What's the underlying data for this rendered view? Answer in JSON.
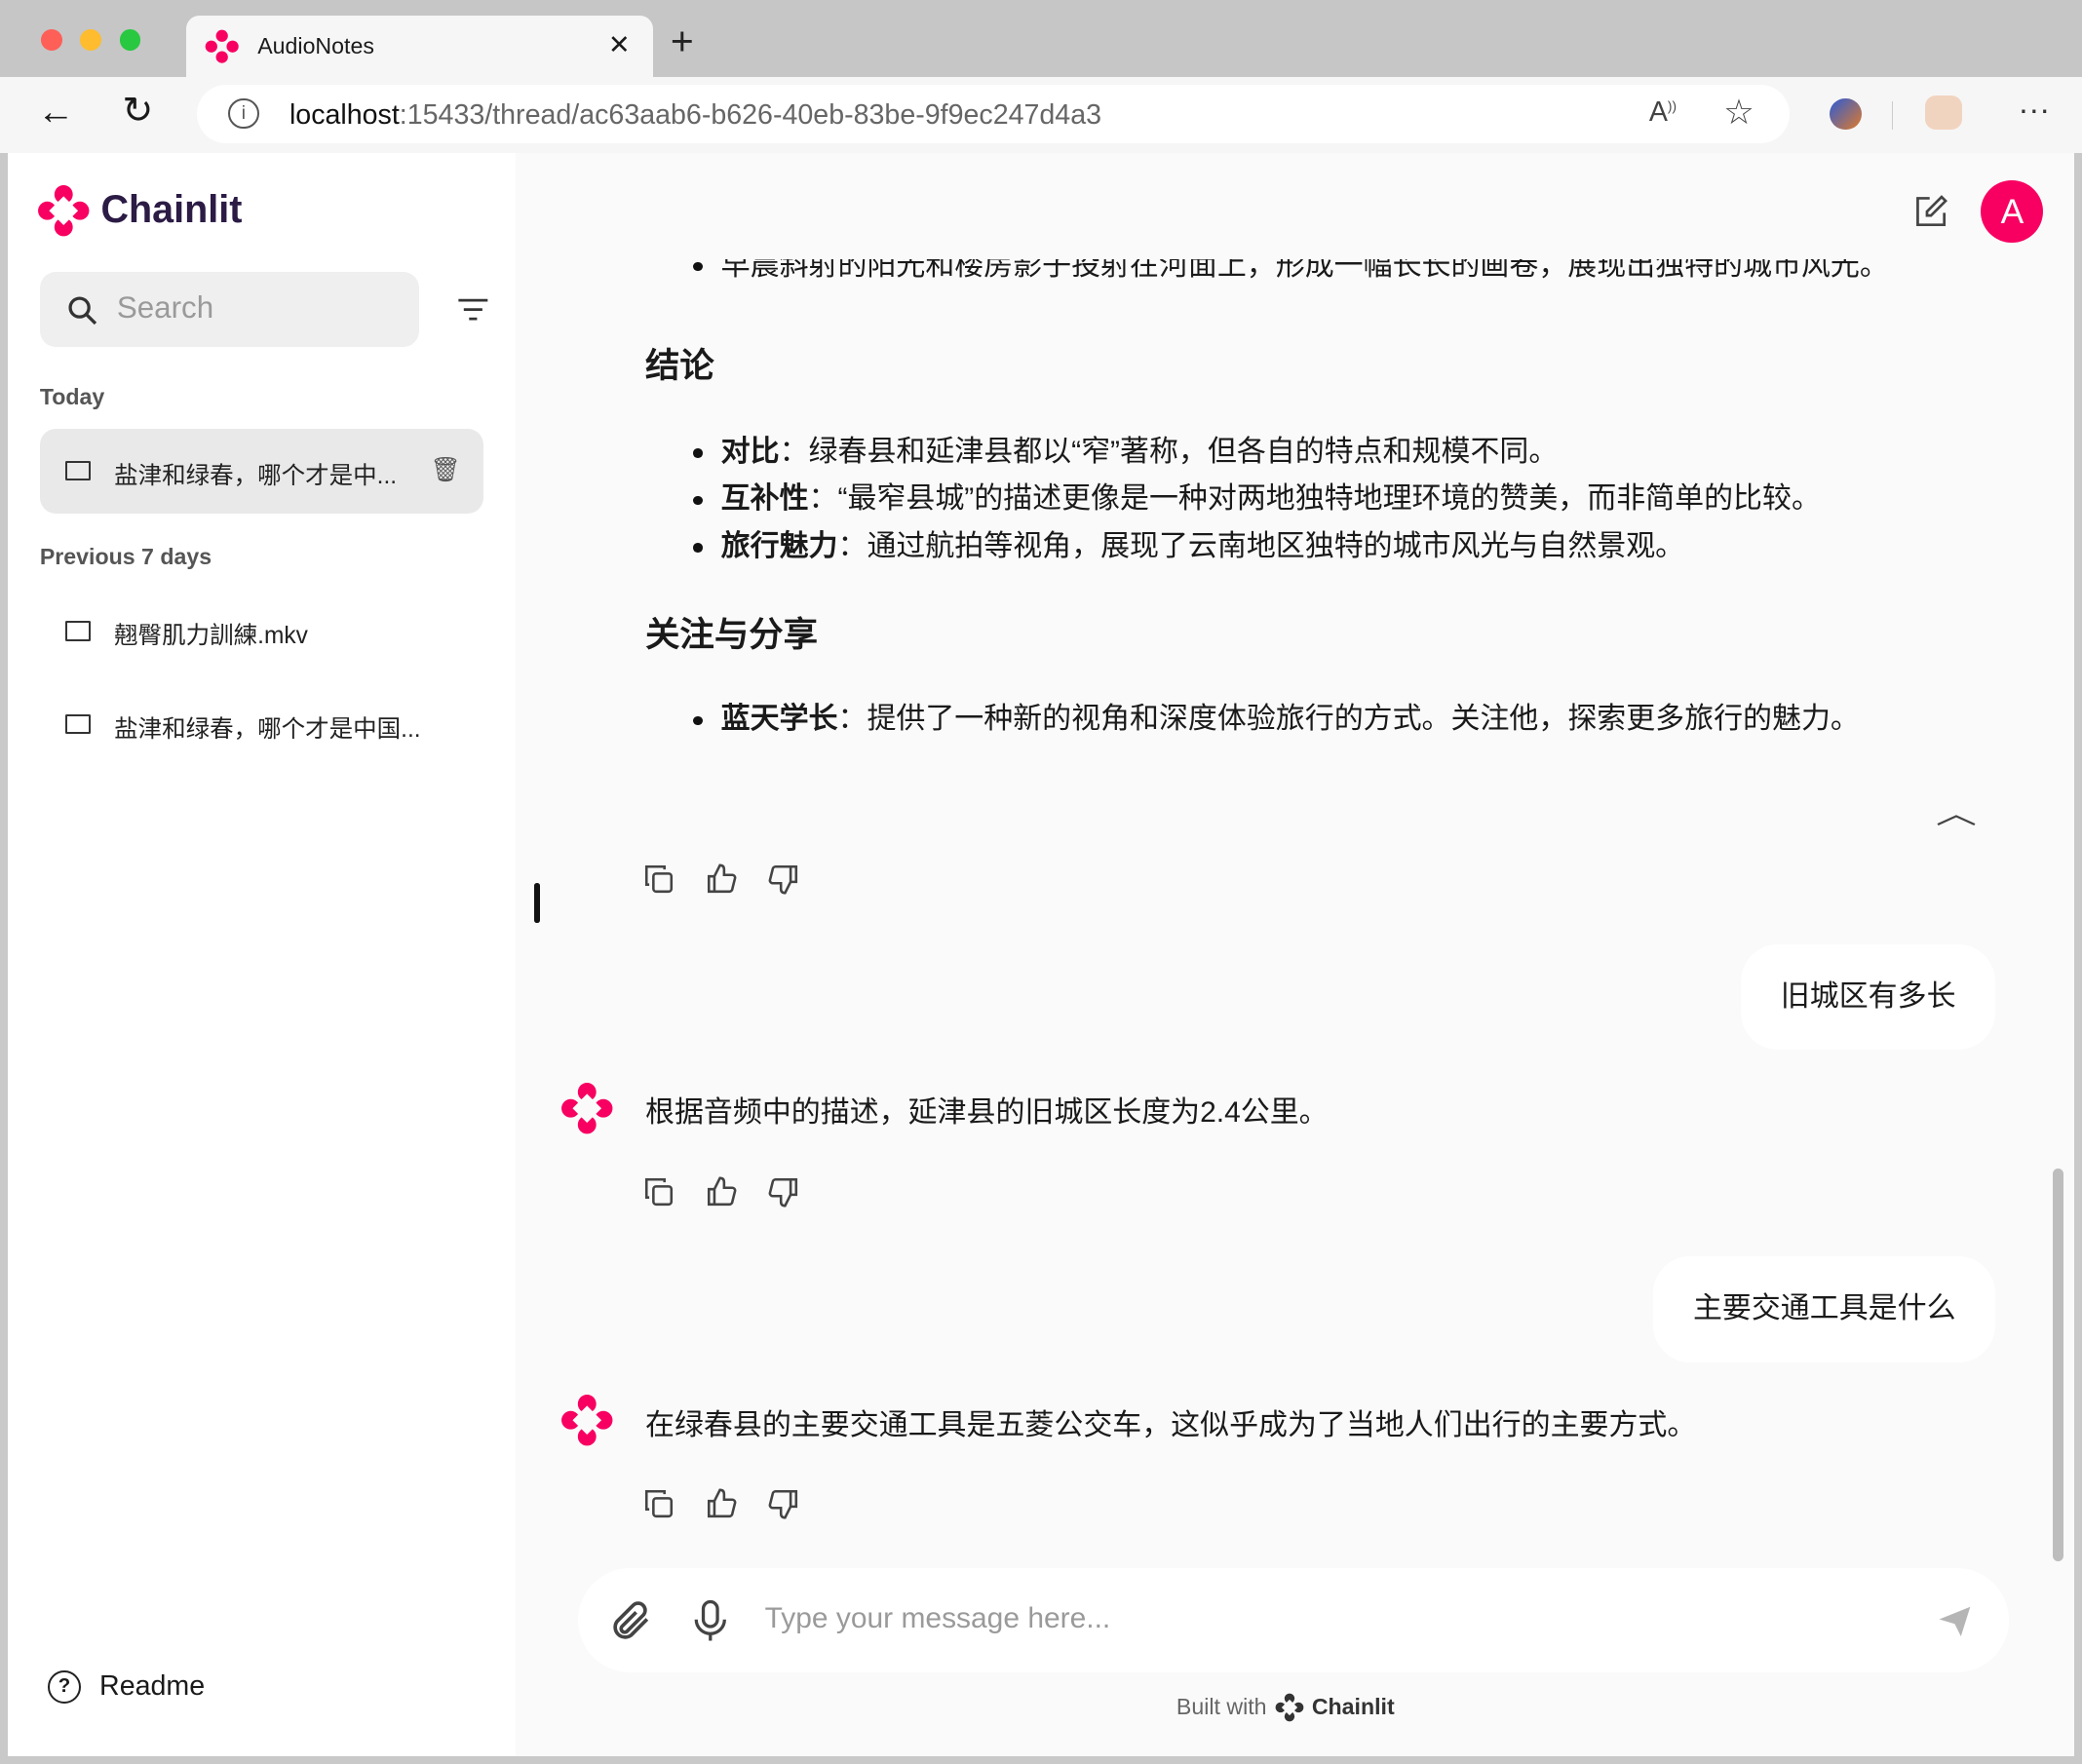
{
  "browser": {
    "tab_title": "AudioNotes",
    "url_host": "localhost",
    "url_path": ":15433/thread/ac63aab6-b626-40eb-83be-9f9ec247d4a3"
  },
  "sidebar": {
    "brand": "Chainlit",
    "search_placeholder": "Search",
    "sections": [
      {
        "title": "Today",
        "threads": [
          "盐津和绿春，哪个才是中..."
        ]
      },
      {
        "title": "Previous 7 days",
        "threads": [
          "翹臀肌力訓練.mkv",
          "盐津和绿春，哪个才是中国..."
        ]
      }
    ],
    "readme": "Readme"
  },
  "header": {
    "avatar_letter": "A"
  },
  "chat": {
    "partial_bullet": "早晨斜射的阳光和楼房影子投射在河面上，形成一幅长长的画卷，展现出独特的城市风光。",
    "conclusion_heading": "结论",
    "conclusion_items": [
      {
        "term": "对比",
        "text": "：绿春县和延津县都以“窄”著称，但各自的特点和规模不同。"
      },
      {
        "term": "互补性",
        "text": "：“最窄县城”的描述更像是一种对两地独特地理环境的赞美，而非简单的比较。"
      },
      {
        "term": "旅行魅力",
        "text": "：通过航拍等视角，展现了云南地区独特的城市风光与自然景观。"
      }
    ],
    "share_heading": "关注与分享",
    "share_items": [
      {
        "term": "蓝天学长",
        "text": "：提供了一种新的视角和深度体验旅行的方式。关注他，探索更多旅行的魅力。"
      }
    ],
    "messages": [
      {
        "role": "user",
        "text": "旧城区有多长"
      },
      {
        "role": "assistant",
        "text": "根据音频中的描述，延津县的旧城区长度为2.4公里。"
      },
      {
        "role": "user",
        "text": "主要交通工具是什么"
      },
      {
        "role": "assistant",
        "text": "在绿春县的主要交通工具是五菱公交车，这似乎成为了当地人们出行的主要方式。"
      }
    ]
  },
  "composer": {
    "placeholder": "Type your message here..."
  },
  "footer": {
    "built_with": "Built with",
    "brand": "Chainlit"
  },
  "colors": {
    "brand": "#F80061",
    "brand_text": "#2B1B45"
  }
}
